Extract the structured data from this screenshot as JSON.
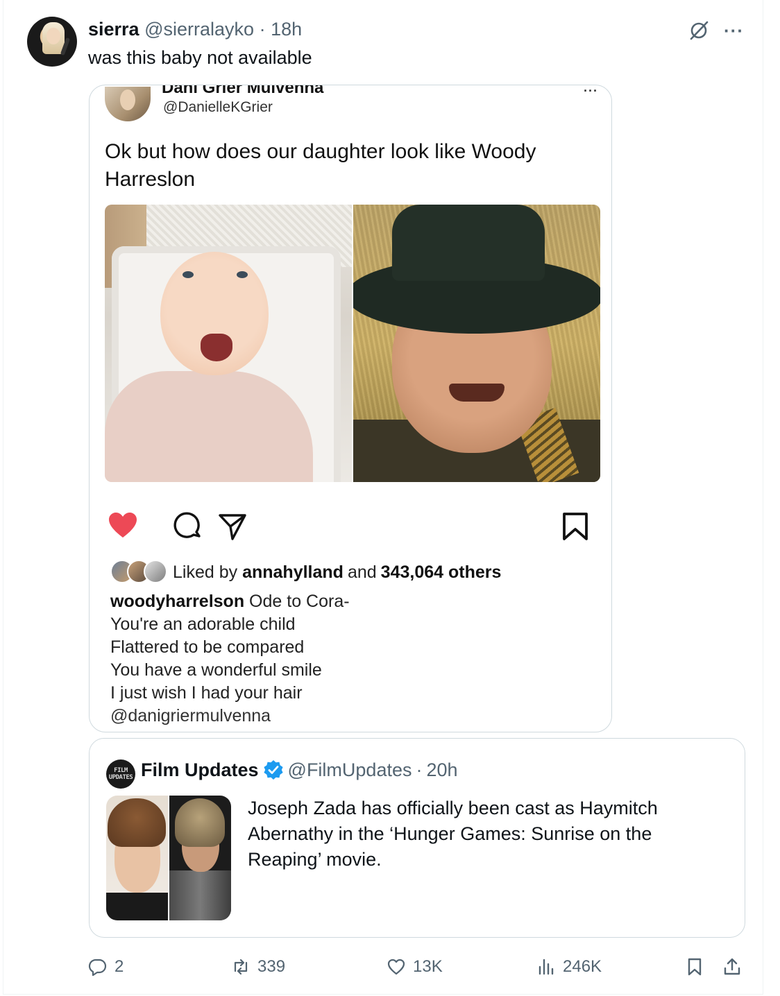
{
  "tweet": {
    "author_name": "sierra",
    "author_handle": "@sierralayko",
    "separator": "·",
    "time": "18h",
    "text": "was this baby not available",
    "more_label": "···"
  },
  "embedded_post": {
    "author_name": "Dani Grier Mulvenna",
    "author_handle": "@DanielleKGrier",
    "more_label": "···",
    "caption": "Ok but how does our daughter look like Woody Harreslon",
    "liked_prefix": "Liked by",
    "liked_user": "annahylland",
    "liked_and": "and",
    "liked_count": "343,064 others",
    "comment_user": "woodyharrelson",
    "comment_first_line": "Ode to Cora-",
    "comment_lines": [
      "You're an adorable child",
      "Flattered to be compared",
      "You have a wonderful smile",
      "I just wish I had your hair"
    ],
    "comment_mention": "@danigriermulvenna",
    "heart_color": "#ed4956"
  },
  "quoted_tweet": {
    "avatar_text": "FILM UPDATES",
    "author_name": "Film Updates",
    "author_handle": "@FilmUpdates",
    "separator": "·",
    "time": "20h",
    "text": "Joseph Zada has officially been cast as Haymitch Abernathy in the ‘Hunger Games: Sunrise on the Reaping’ movie.",
    "verified_color": "#1d9bf0"
  },
  "actions": {
    "replies": "2",
    "retweets": "339",
    "likes": "13K",
    "views": "246K"
  },
  "colors": {
    "text": "#0f1419",
    "secondary": "#536471",
    "border": "#cfd9de"
  }
}
